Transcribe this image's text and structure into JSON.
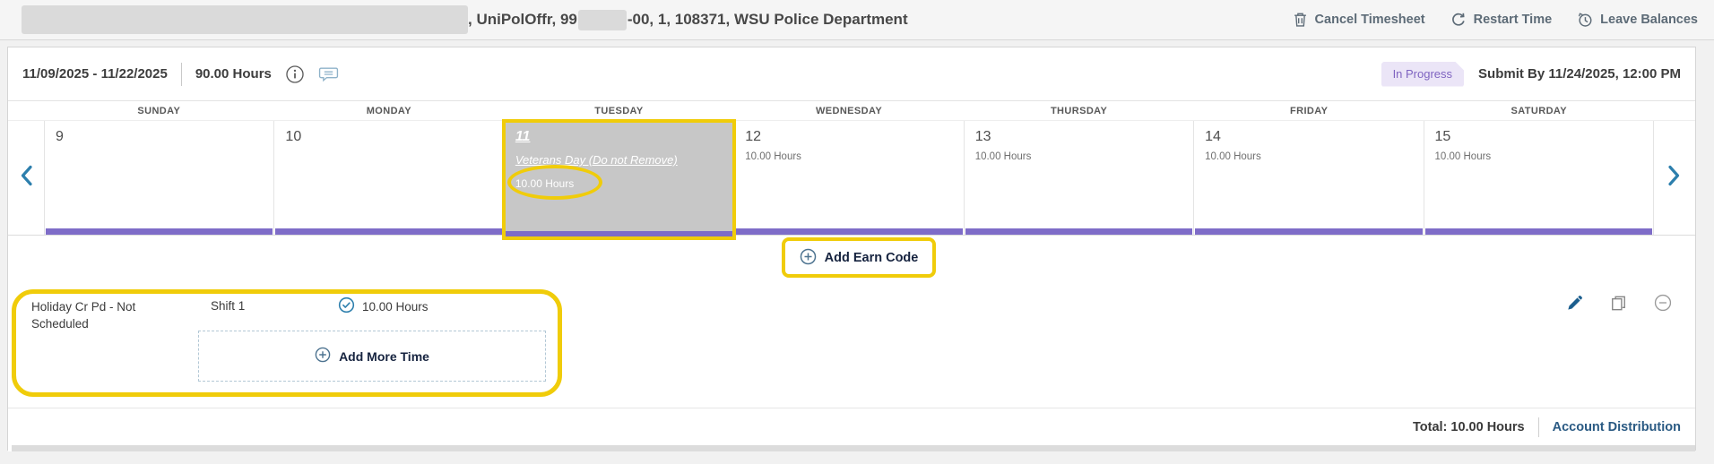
{
  "header": {
    "title_mid": ", UniPolOffr, 99",
    "title_suffix": "-00, 1, 108371, WSU Police Department",
    "actions": [
      {
        "label": "Cancel Timesheet",
        "icon": "trash-icon"
      },
      {
        "label": "Restart Time",
        "icon": "restart-icon"
      },
      {
        "label": "Leave Balances",
        "icon": "clock-history-icon"
      }
    ]
  },
  "period_bar": {
    "date_range": "11/09/2025 - 11/22/2025",
    "total_hours": "90.00 Hours",
    "status_badge": "In Progress",
    "submit_by": "Submit By 11/24/2025, 12:00 PM"
  },
  "calendar": {
    "day_names": [
      "SUNDAY",
      "MONDAY",
      "TUESDAY",
      "WEDNESDAY",
      "THURSDAY",
      "FRIDAY",
      "SATURDAY"
    ],
    "days": [
      {
        "number": "9",
        "hours": ""
      },
      {
        "number": "10",
        "hours": ""
      },
      {
        "number": "11",
        "holiday": "Veterans Day (Do not Remove)",
        "hours": "10.00 Hours",
        "selected": true
      },
      {
        "number": "12",
        "hours": "10.00 Hours"
      },
      {
        "number": "13",
        "hours": "10.00 Hours"
      },
      {
        "number": "14",
        "hours": "10.00 Hours"
      },
      {
        "number": "15",
        "hours": "10.00 Hours"
      }
    ]
  },
  "entry_panel": {
    "add_earn_code_label": "Add Earn Code",
    "entry": {
      "earn_code": "Holiday Cr Pd - Not Scheduled",
      "shift": "Shift 1",
      "hours": "10.00 Hours",
      "add_more_label": "Add More Time"
    }
  },
  "footer": {
    "total_label": "Total: 10.00 Hours",
    "account_distribution_label": "Account Distribution"
  },
  "colors": {
    "accent_purple": "#7e6cc8",
    "annotation_yellow": "#f0cc0a",
    "badge_bg": "#ebe5f7",
    "badge_text": "#7f64c1",
    "chevron_blue": "#2d7fad",
    "link_blue": "#2a5a83",
    "selected_day_bg": "#c7c7c7"
  }
}
